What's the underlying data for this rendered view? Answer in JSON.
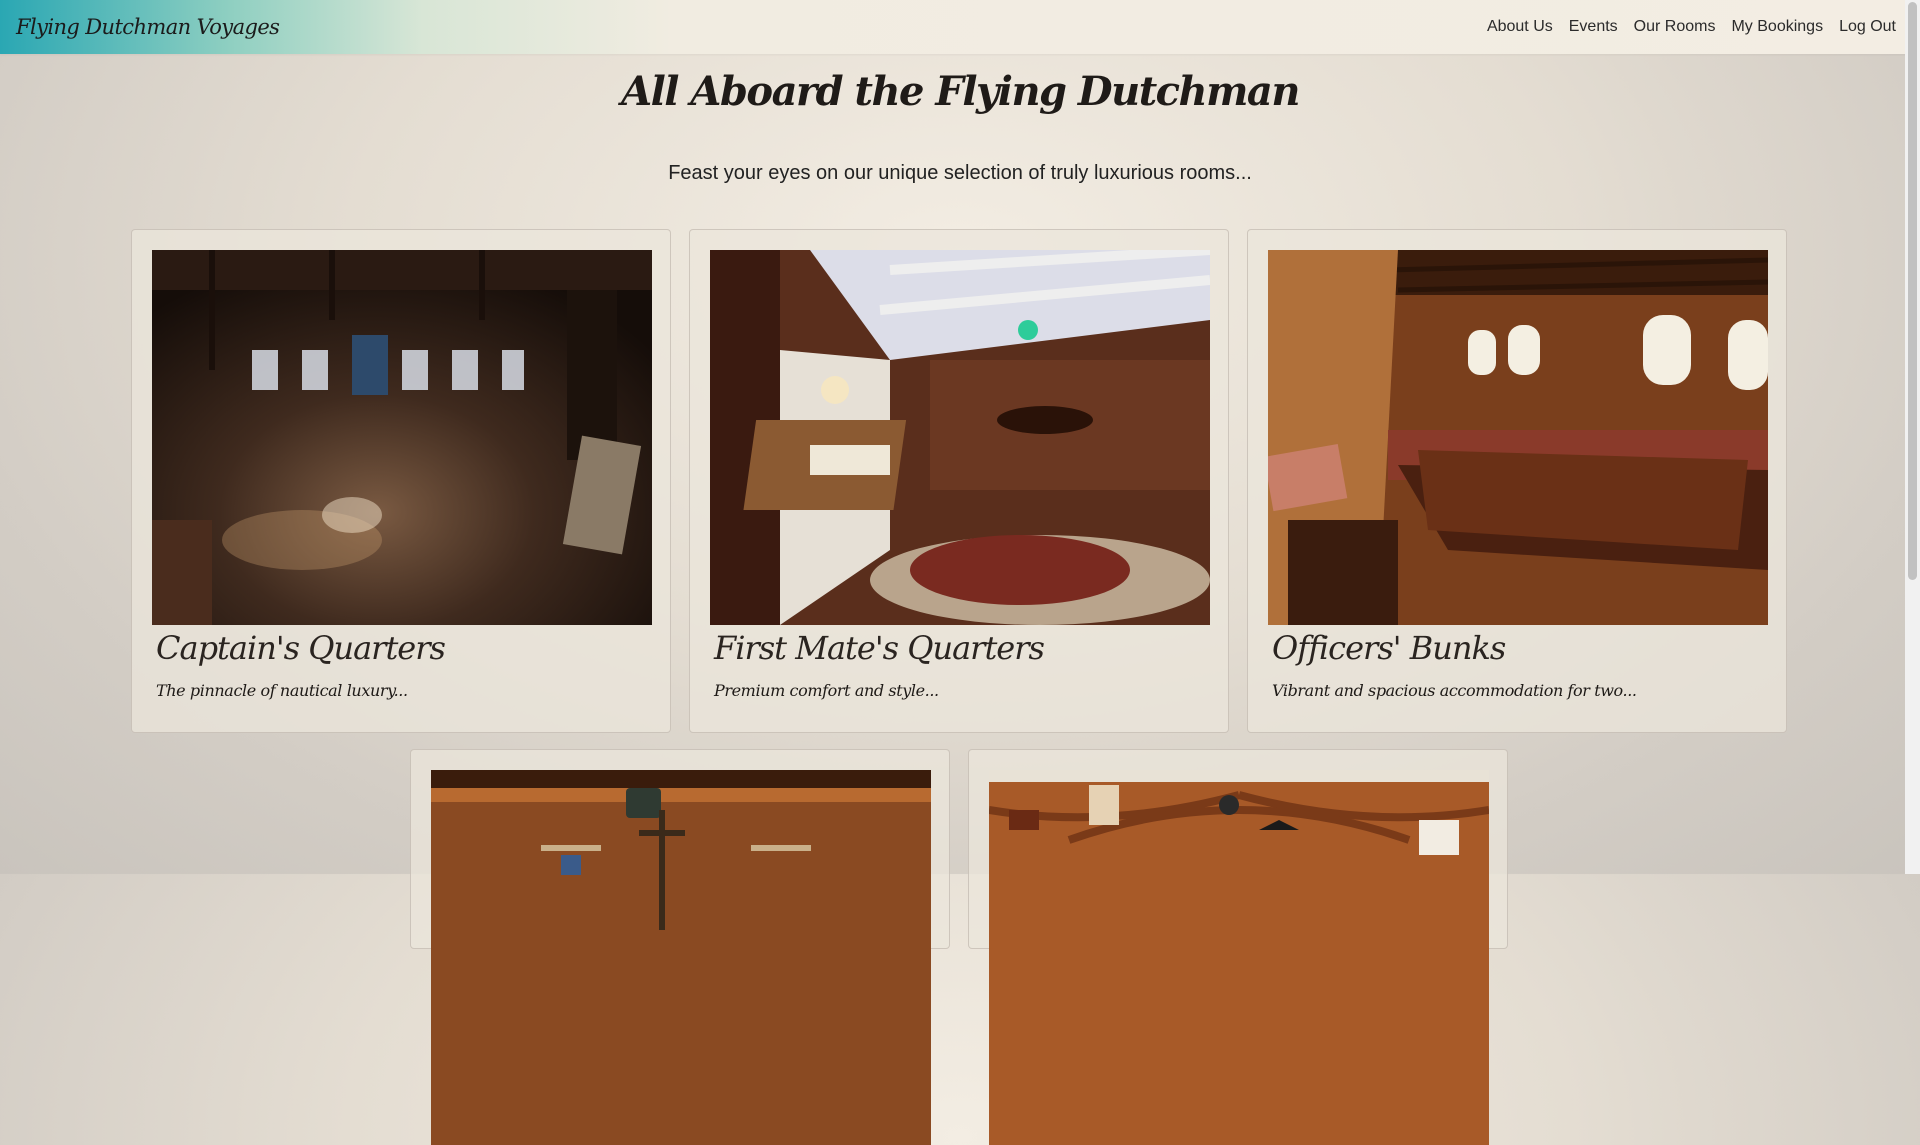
{
  "nav": {
    "brand": "Flying Dutchman Voyages",
    "links": [
      "About Us",
      "Events",
      "Our Rooms",
      "My Bookings",
      "Log Out"
    ]
  },
  "hero": {
    "title": "All Aboard the Flying Dutchman",
    "tagline": "Feast your eyes on our unique selection of truly luxurious rooms..."
  },
  "rooms": [
    {
      "name": "Captain's Quarters",
      "description": "The pinnacle of nautical luxury..."
    },
    {
      "name": "First Mate's Quarters",
      "description": "Premium comfort and style..."
    },
    {
      "name": "Officers' Bunks",
      "description": "Vibrant and spacious accommodation for two..."
    },
    {
      "name": "",
      "description": ""
    },
    {
      "name": "",
      "description": ""
    }
  ]
}
